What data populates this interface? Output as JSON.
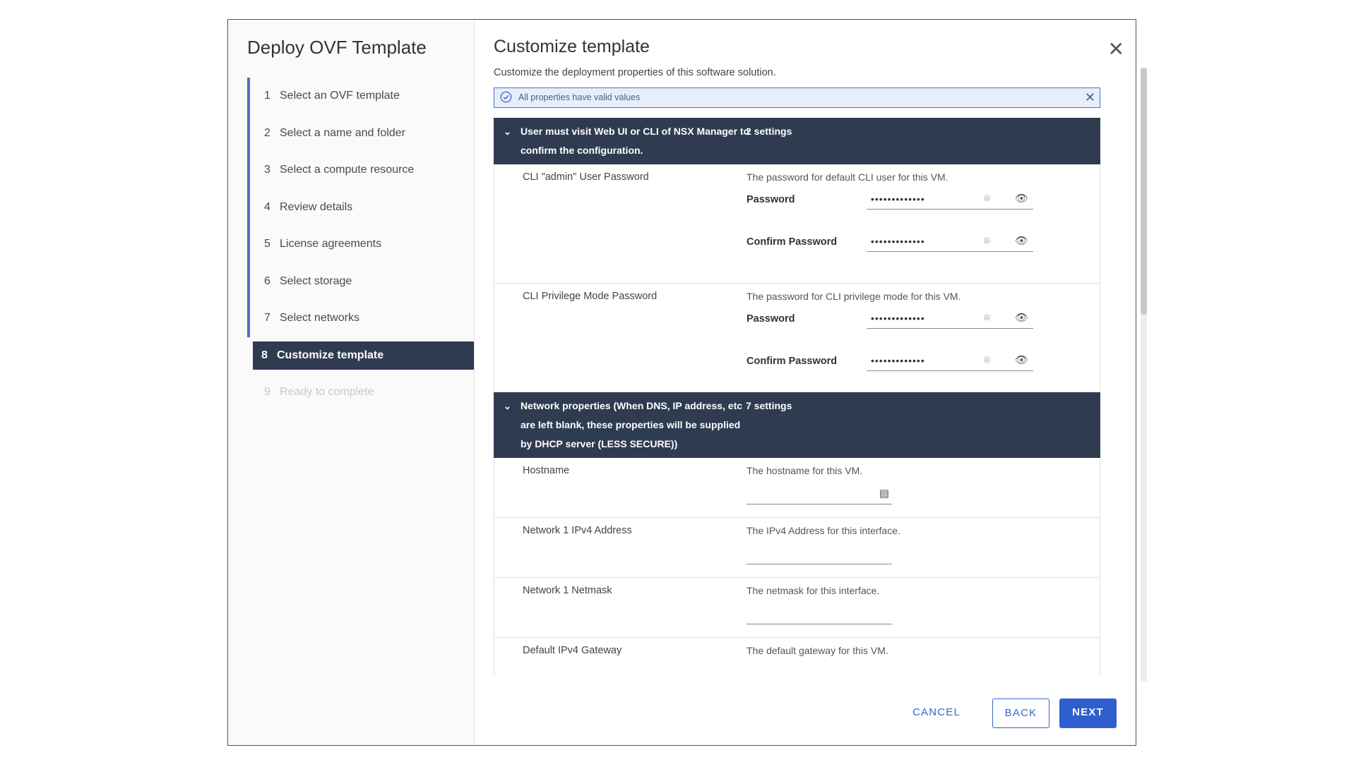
{
  "wizard": {
    "title": "Deploy OVF Template",
    "steps": [
      {
        "num": "1",
        "label": "Select an OVF template"
      },
      {
        "num": "2",
        "label": "Select a name and folder"
      },
      {
        "num": "3",
        "label": "Select a compute resource"
      },
      {
        "num": "4",
        "label": "Review details"
      },
      {
        "num": "5",
        "label": "License agreements"
      },
      {
        "num": "6",
        "label": "Select storage"
      },
      {
        "num": "7",
        "label": "Select networks"
      },
      {
        "num": "8",
        "label": "Customize template"
      },
      {
        "num": "9",
        "label": "Ready to complete"
      }
    ],
    "active_step": 8
  },
  "page": {
    "title": "Customize template",
    "subtitle": "Customize the deployment properties of this software solution.",
    "alert": "All properties have valid values"
  },
  "sections": [
    {
      "title": "User must visit Web UI or CLI of NSX Manager to confirm the configuration.",
      "count": "2 settings",
      "props": [
        {
          "label": "CLI \"admin\" User Password",
          "description": "The password for default CLI user for this VM.",
          "password_label": "Password",
          "password_value": "•••••••••••••",
          "confirm_label": "Confirm Password",
          "confirm_value": "•••••••••••••"
        },
        {
          "label": "CLI Privilege Mode Password",
          "description": "The password for CLI privilege mode for this VM.",
          "password_label": "Password",
          "password_value": "•••••••••••••",
          "confirm_label": "Confirm Password",
          "confirm_value": "•••••••••••••"
        }
      ]
    },
    {
      "title": "Network properties (When DNS, IP address, etc are left blank, these properties will be supplied by DHCP server (LESS SECURE))",
      "count": "7 settings",
      "props": [
        {
          "label": "Hostname",
          "description": "The hostname for this VM."
        },
        {
          "label": "Network 1 IPv4 Address",
          "description": "The IPv4 Address for this interface."
        },
        {
          "label": "Network 1 Netmask",
          "description": "The netmask for this interface."
        },
        {
          "label": "Default IPv4 Gateway",
          "description": "The default gateway for this VM."
        }
      ]
    }
  ],
  "buttons": {
    "cancel": "CANCEL",
    "back": "BACK",
    "next": "NEXT"
  },
  "icons": {
    "close": "close-icon",
    "chevron": "chevron-down-icon",
    "check": "check-circle-icon",
    "eye": "eye-icon",
    "key": "password-manager-icon",
    "contact": "contact-card-icon"
  },
  "colors": {
    "header_bg": "#2f3b51",
    "accent": "#2f5fcf",
    "step_bar": "#4a72c4"
  }
}
